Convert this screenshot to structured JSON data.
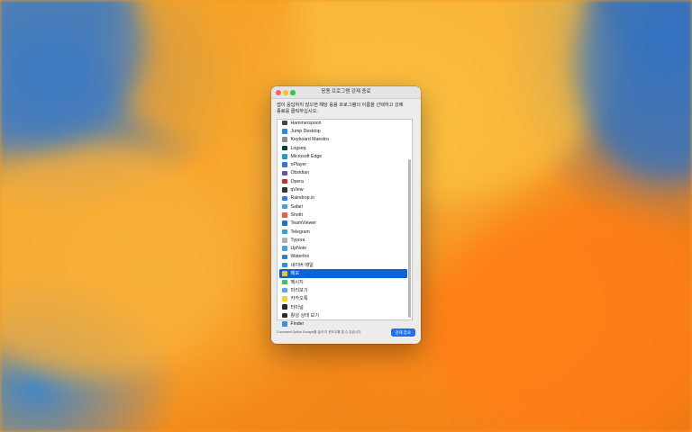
{
  "window": {
    "title": "응용 프로그램 강제 종료",
    "description_lines": [
      "앱이 응답하지 않으면 해당 응용 프로그램의 이름을 선택하고 강제",
      "종료를 클릭하십시오."
    ]
  },
  "apps": [
    {
      "label": "Hammerspoon",
      "icon": "hammerspoon-icon",
      "color": "#444444"
    },
    {
      "label": "Jump Desktop",
      "icon": "jump-desktop-icon",
      "color": "#2b8be6"
    },
    {
      "label": "Keyboard Maestro",
      "icon": "keyboard-maestro-icon",
      "color": "#8c8c8c"
    },
    {
      "label": "Logseq",
      "icon": "logseq-icon",
      "color": "#0b3a48"
    },
    {
      "label": "Microsoft Edge",
      "icon": "edge-icon",
      "color": "#1a9bd6"
    },
    {
      "label": "nPlayer",
      "icon": "nplayer-icon",
      "color": "#3a74d6"
    },
    {
      "label": "Obsidian",
      "icon": "obsidian-icon",
      "color": "#6b4fbb"
    },
    {
      "label": "Opera",
      "icon": "opera-icon",
      "color": "#e0202f"
    },
    {
      "label": "qView",
      "icon": "qview-icon",
      "color": "#333333"
    },
    {
      "label": "Raindrop.io",
      "icon": "raindrop-icon",
      "color": "#2f7be6"
    },
    {
      "label": "Safari",
      "icon": "safari-icon",
      "color": "#3aa0f0"
    },
    {
      "label": "Shottr",
      "icon": "shottr-icon",
      "color": "#f05a3a"
    },
    {
      "label": "TeamViewer",
      "icon": "teamviewer-icon",
      "color": "#1d6fe0"
    },
    {
      "label": "Telegram",
      "icon": "telegram-icon",
      "color": "#2aa3e0"
    },
    {
      "label": "Typora",
      "icon": "typora-icon",
      "color": "#b0b0b0"
    },
    {
      "label": "UpNote",
      "icon": "upnote-icon",
      "color": "#4aa0e8"
    },
    {
      "label": "Waterfox",
      "icon": "waterfox-icon",
      "color": "#2c7fd9"
    },
    {
      "label": "네이버 메일",
      "icon": "naver-mail-icon",
      "color": "#1a9ad6"
    },
    {
      "label": "메모",
      "icon": "notes-icon",
      "color": "#f5c21b",
      "selected": true
    },
    {
      "label": "메시지",
      "icon": "messages-icon",
      "color": "#33c759"
    },
    {
      "label": "미리보기",
      "icon": "preview-icon",
      "color": "#5aa9e8"
    },
    {
      "label": "카카오톡",
      "icon": "kakaotalk-icon",
      "color": "#f7d51d"
    },
    {
      "label": "터미널",
      "icon": "terminal-icon",
      "color": "#2b2b2b"
    },
    {
      "label": "활성 상태 보기",
      "icon": "activity-monitor-icon",
      "color": "#2b2b2b"
    },
    {
      "label": "Finder",
      "icon": "finder-icon",
      "color": "#3b8de6"
    }
  ],
  "footer": {
    "hint": "Command Option Escape를 눌러 이 윈도우를 열 수 있습니다.",
    "force_quit_label": "강제 종료"
  }
}
